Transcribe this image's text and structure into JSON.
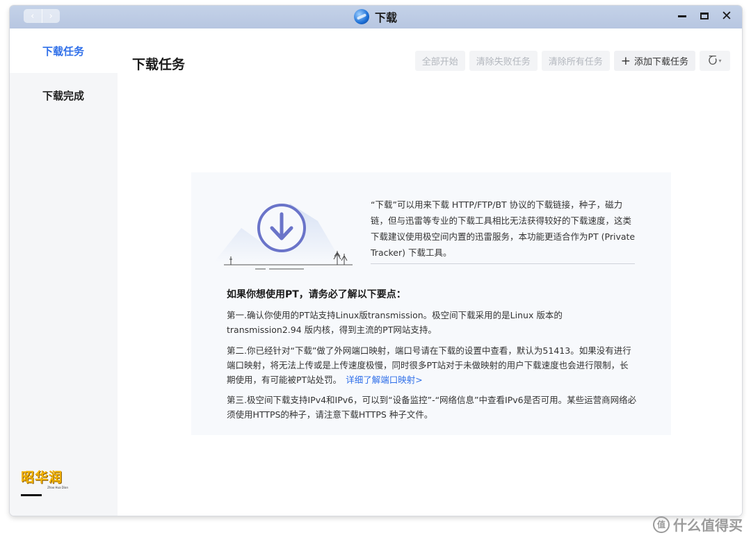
{
  "window": {
    "title": "下载",
    "nav_back_icon": "‹",
    "nav_forward_icon": "›",
    "close_glyph": "✕"
  },
  "sidebar": {
    "items": [
      {
        "label": "下载任务",
        "active": true
      },
      {
        "label": "下载完成",
        "active": false
      }
    ],
    "watermark": "昭华润",
    "watermark_sub": "Zhao Hua Dian"
  },
  "main": {
    "title": "下载任务",
    "toolbar": {
      "start_all": "全部开始",
      "clear_failed": "清除失败任务",
      "clear_all": "清除所有任务",
      "add_task_icon": "+",
      "add_task": "添加下载任务",
      "speed_icon": "Ⴀ",
      "dropdown_icon": "▾"
    }
  },
  "info": {
    "intro": "“下载”可以用来下载 HTTP/FTP/BT 协议的下载链接，种子，磁力链，但与迅雷等专业的下载工具相比无法获得较好的下载速度，这类下载建议使用极空间内置的迅雷服务，本功能更适合作为PT (Private Tracker) 下载工具。",
    "heading": "如果你想使用PT，请务必了解以下要点：",
    "point1": "第一.确认你使用的PT站支持Linux版transmission。极空间下载采用的是Linux 版本的 transmission2.94 版内核，得到主流的PT网站支持。",
    "point2": "第二.你已经针对“下载”做了外网端口映射，端口号请在下载的设置中查看，默认为51413。如果没有进行端口映射，将无法上传或是上传速度极慢，同时很多PT站对于未做映射的用户下载速度也会进行限制，长期使用，有可能被PT站处罚。",
    "point2_link": "详细了解端口映射>",
    "point3": "第三.极空间下载支持IPv4和IPv6，可以到“设备监控”-“网络信息”中查看IPv6是否可用。某些运营商网络必须使用HTTPS的种子，请注意下载HTTPS 种子文件。"
  },
  "corner": {
    "icon": "值",
    "text": "什么值得买"
  },
  "colors": {
    "accent": "#2f6fe9",
    "titlebar": "#bccae3"
  }
}
